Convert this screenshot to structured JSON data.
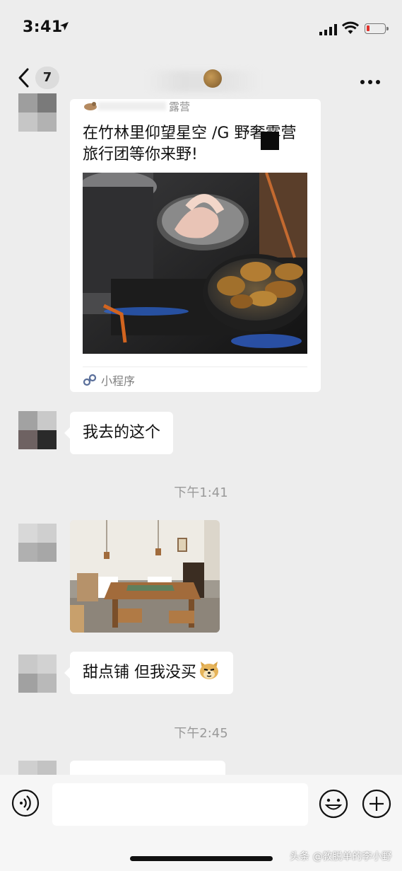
{
  "status_bar": {
    "time": "3:41"
  },
  "nav": {
    "unread_count": "7"
  },
  "messages": {
    "card": {
      "source_suffix": "露营",
      "title": "在竹林里仰望星空 /G 野奢露营旅行团等你来野!",
      "footer_label": "小程序"
    },
    "msg1": {
      "text": "我去的这个"
    },
    "timestamp1": "下午1:41",
    "msg2": {
      "text": "甜点铺 但我没买"
    },
    "timestamp2": "下午2:45"
  },
  "watermark": "头条 @教脱单的李小野",
  "colors": {
    "background": "#ededed",
    "bubble": "#ffffff",
    "timestamp": "#9a9a9a",
    "battery_low": "#e0312b",
    "mini_program_link": "#5a6f9a"
  },
  "icons": [
    "location-arrow-icon",
    "signal-icon",
    "wifi-icon",
    "battery-icon",
    "back-chevron-icon",
    "more-icon",
    "voice-icon",
    "emoji-icon",
    "plus-icon",
    "mini-program-icon"
  ]
}
